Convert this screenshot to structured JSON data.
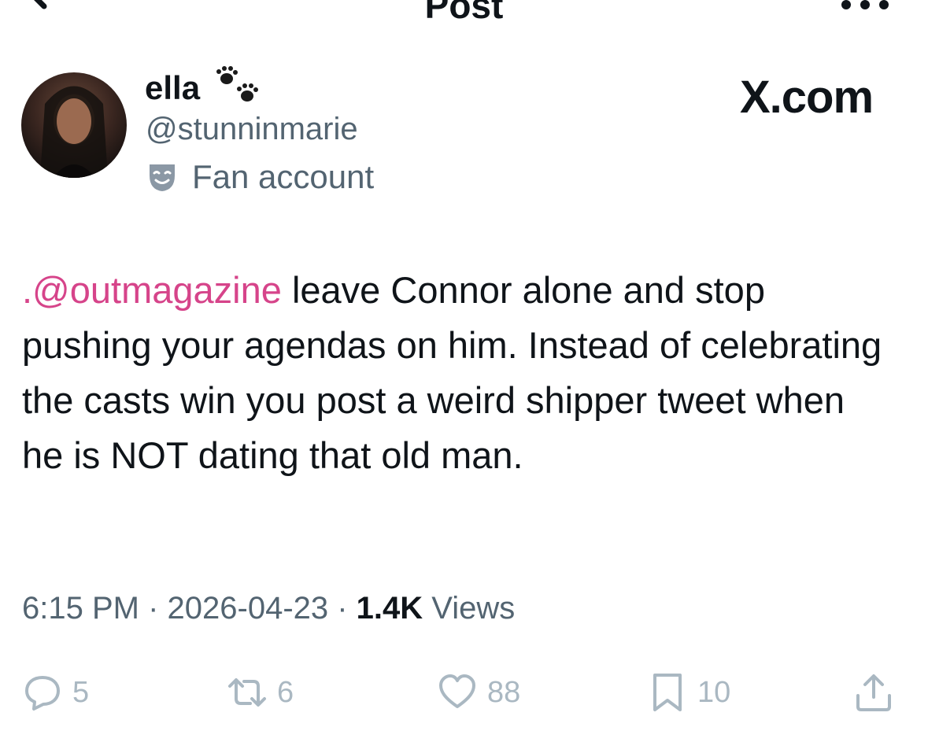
{
  "header": {
    "title": "Post",
    "back_icon": "arrow-left-icon",
    "more_icon": "more-dots-icon"
  },
  "author": {
    "display_name": "ella",
    "emoji": "paw-prints",
    "handle": "@stunninmarie",
    "label": "Fan account"
  },
  "watermark": "X.com",
  "tweet": {
    "mention": ".@outmagazine",
    "text": " leave Connor alone and stop pushing your agendas on him. Instead of celebrating the casts win you post a weird shipper tweet when he is NOT dating that old man."
  },
  "meta": {
    "time": "6:15 PM",
    "date": "2026-04-23",
    "views_count": "1.4K",
    "views_label": " Views",
    "sep": " · "
  },
  "actions": {
    "reply_count": "5",
    "repost_count": "6",
    "like_count": "88",
    "bookmark_count": "10"
  },
  "colors": {
    "mention": "#d6448a",
    "secondary_text": "#536471",
    "icon_faded": "#aab8c2"
  }
}
